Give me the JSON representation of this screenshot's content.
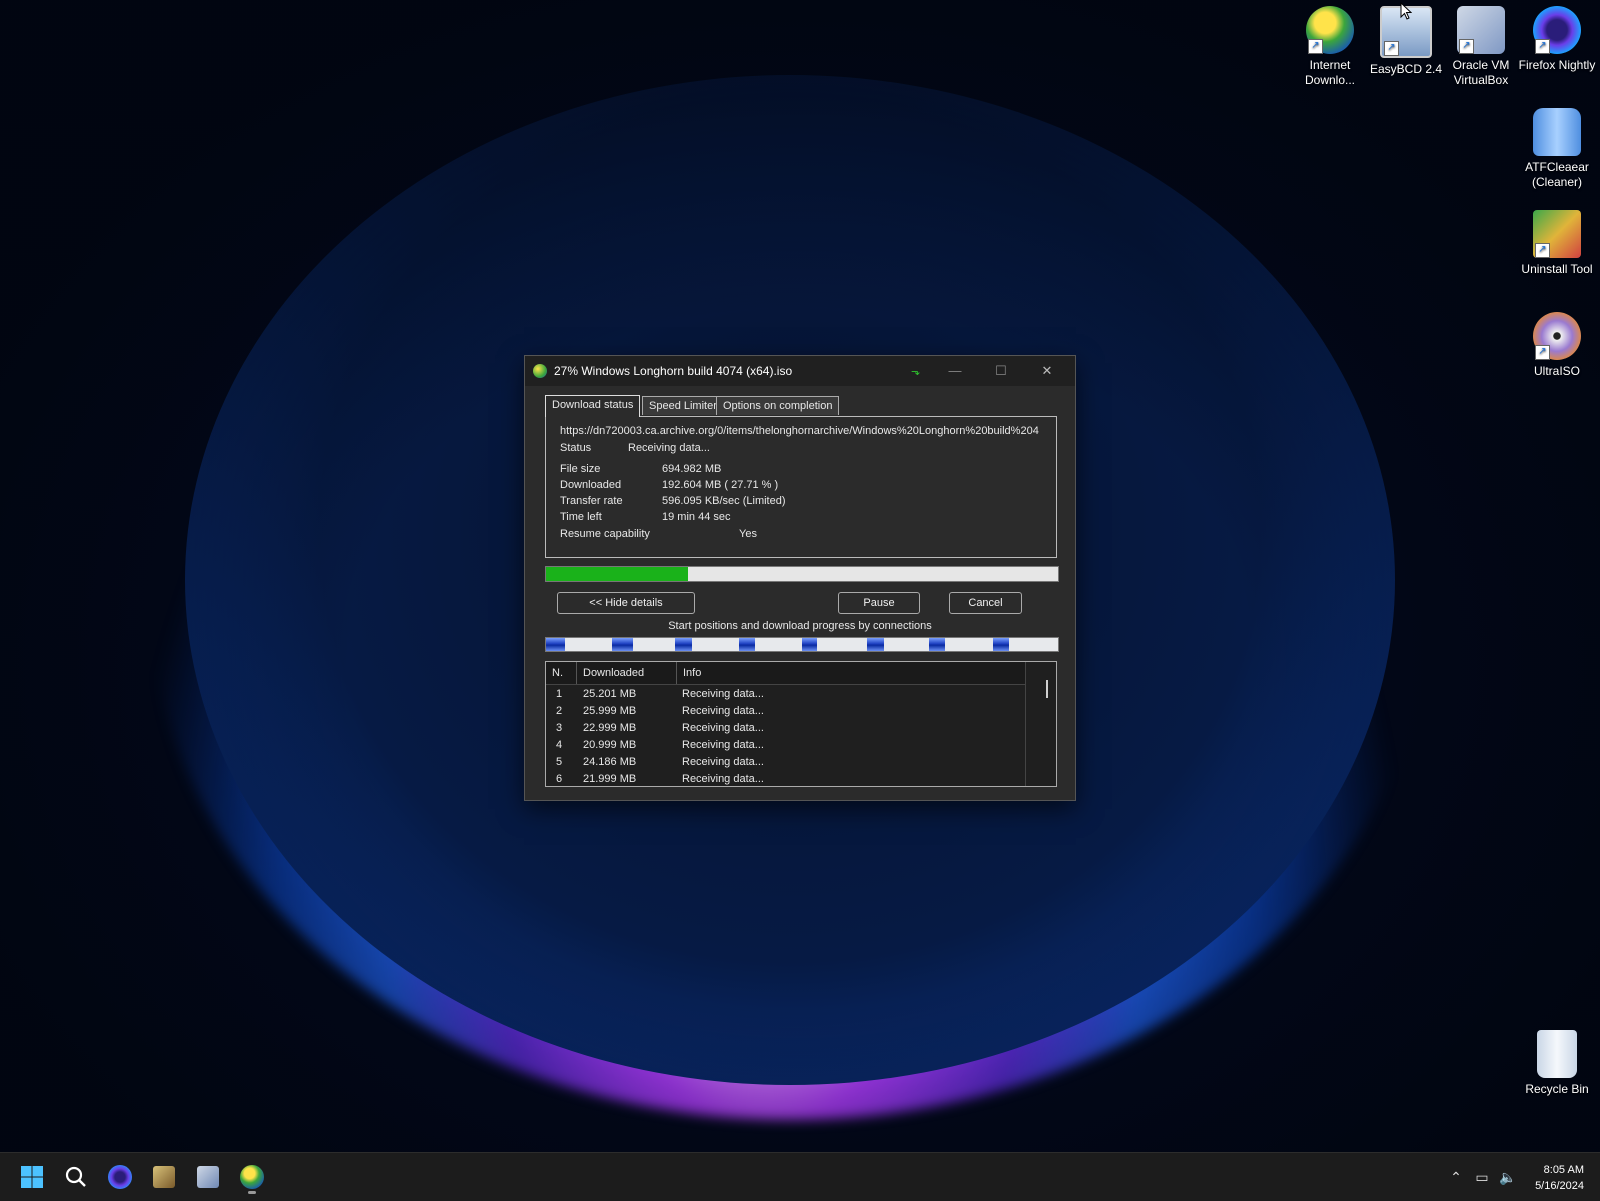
{
  "desktop_icons": [
    {
      "label": "Internet Downlo...",
      "icon": "idm-icon"
    },
    {
      "label": "EasyBCD 2.4",
      "icon": "easybcd-icon"
    },
    {
      "label": "Oracle VM VirtualBox",
      "icon": "virtualbox-icon"
    },
    {
      "label": "Firefox Nightly",
      "icon": "firefox-nightly-icon"
    },
    {
      "label": "ATFCleaear (Cleaner)",
      "icon": "atfcleaner-icon"
    },
    {
      "label": "Uninstall Tool",
      "icon": "uninstall-tool-icon"
    },
    {
      "label": "UltraISO",
      "icon": "ultraiso-icon"
    },
    {
      "label": "Recycle Bin",
      "icon": "recycle-bin-icon"
    }
  ],
  "dialog": {
    "title": "27% Windows Longhorn build 4074 (x64).iso",
    "window_controls": {
      "minimize": "—",
      "maximize": "☐",
      "close": "✕"
    },
    "tabs": [
      "Download status",
      "Speed Limiter",
      "Options on completion"
    ],
    "url": "https://dn720003.ca.archive.org/0/items/thelonghornarchive/Windows%20Longhorn%20build%204",
    "status": {
      "label": "Status",
      "value": "Receiving data..."
    },
    "file_size": {
      "label": "File size",
      "value": "694.982  MB"
    },
    "downloaded": {
      "label": "Downloaded",
      "value": "192.604  MB  ( 27.71 % )"
    },
    "transfer_rate": {
      "label": "Transfer rate",
      "value": "596.095  KB/sec  (Limited)"
    },
    "time_left": {
      "label": "Time left",
      "value": "19 min 44 sec"
    },
    "resume": {
      "label": "Resume capability",
      "value": "Yes"
    },
    "progress_fraction": 0.2771,
    "progress_color": "#1ab21a",
    "buttons": {
      "hide_details": "<< Hide details",
      "pause": "Pause",
      "cancel": "Cancel"
    },
    "connections_label": "Start positions and download progress by connections",
    "connections_table": {
      "headers": [
        "N.",
        "Downloaded",
        "Info"
      ],
      "rows": [
        {
          "n": "1",
          "downloaded": "25.201  MB",
          "info": "Receiving data..."
        },
        {
          "n": "2",
          "downloaded": "25.999  MB",
          "info": "Receiving data..."
        },
        {
          "n": "3",
          "downloaded": "22.999  MB",
          "info": "Receiving data..."
        },
        {
          "n": "4",
          "downloaded": "20.999  MB",
          "info": "Receiving data..."
        },
        {
          "n": "5",
          "downloaded": "24.186  MB",
          "info": "Receiving data..."
        },
        {
          "n": "6",
          "downloaded": "21.999  MB",
          "info": "Receiving data..."
        }
      ]
    }
  },
  "taskbar": {
    "apps": [
      "start-icon",
      "search-icon",
      "firefox-nightly-icon",
      "easybcd-icon",
      "virtualbox-icon",
      "idm-icon"
    ],
    "tray": [
      "chevron-up-icon",
      "network-icon",
      "volume-mute-icon"
    ],
    "time": "8:05 AM",
    "date": "5/16/2024"
  }
}
